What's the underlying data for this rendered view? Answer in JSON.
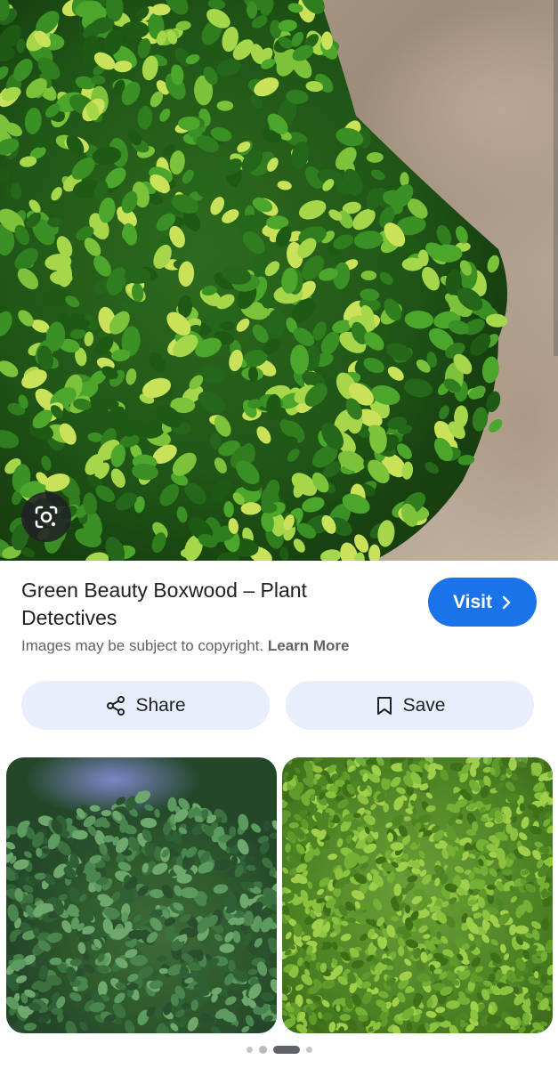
{
  "hero": {
    "image_subject": "boxwood-shrub-photo"
  },
  "result": {
    "title": "Green Beauty Boxwood – Plant Detectives",
    "visit_label": "Visit",
    "copyright_text": "Images may be subject to copyright.",
    "learn_more_label": "Learn More"
  },
  "actions": {
    "share_label": "Share",
    "save_label": "Save"
  },
  "colors": {
    "visit_button": "#1a73e8",
    "action_button_bg": "#e8eefb",
    "text_primary": "#202124",
    "text_secondary": "#5f6368"
  },
  "related": {
    "thumbnails": [
      "boxwood-shrub-with-blue-flowers",
      "dense-green-boxwood-foliage"
    ]
  },
  "pager": {
    "page_count": 4,
    "active_index": 2
  }
}
